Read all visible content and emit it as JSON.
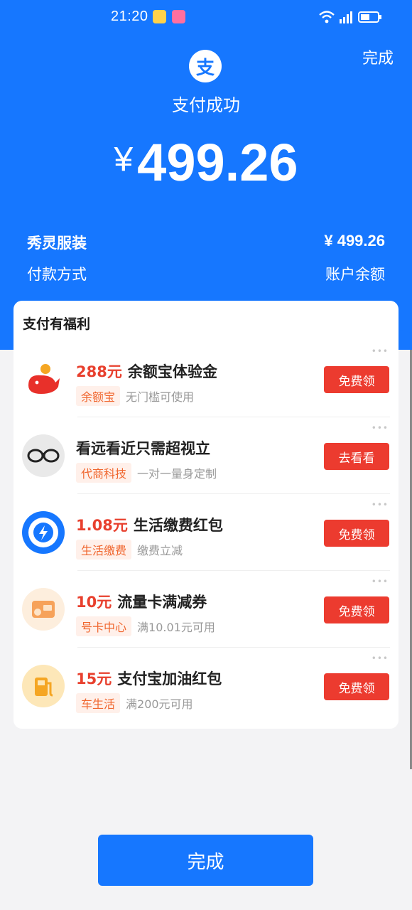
{
  "status_bar": {
    "time": "21:20"
  },
  "header": {
    "done_label": "完成",
    "logo_char": "支",
    "status_text": "支付成功",
    "currency_symbol": "¥",
    "amount": "499.26",
    "merchant_name": "秀灵服装",
    "merchant_amount": "¥ 499.26",
    "payment_method_label": "付款方式",
    "payment_method_value": "账户余额"
  },
  "benefits": {
    "title": "支付有福利",
    "items": [
      {
        "highlight": "288元",
        "name": "余额宝体验金",
        "tag": "余额宝",
        "sub": "无门槛可使用",
        "button": "免费领",
        "icon": "whale-icon"
      },
      {
        "highlight": "",
        "name": "看远看近只需超视立",
        "tag": "代商科技",
        "sub": "一对一量身定制",
        "button": "去看看",
        "icon": "glasses-icon"
      },
      {
        "highlight": "1.08元",
        "name": "生活缴费红包",
        "tag": "生活缴费",
        "sub": "缴费立减",
        "button": "免费领",
        "icon": "lightning-icon"
      },
      {
        "highlight": "10元",
        "name": "流量卡满减券",
        "tag": "号卡中心",
        "sub": "满10.01元可用",
        "button": "免费领",
        "icon": "sim-card-icon"
      },
      {
        "highlight": "15元",
        "name": "支付宝加油红包",
        "tag": "车生活",
        "sub": "满200元可用",
        "button": "免费领",
        "icon": "fuel-pump-icon"
      }
    ]
  },
  "footer": {
    "done_label": "完成"
  },
  "colors": {
    "primary": "#1677ff",
    "cta": "#ec3b2f",
    "highlight": "#e8402e",
    "tag_text": "#f0662e",
    "tag_bg": "#fff0ea"
  }
}
